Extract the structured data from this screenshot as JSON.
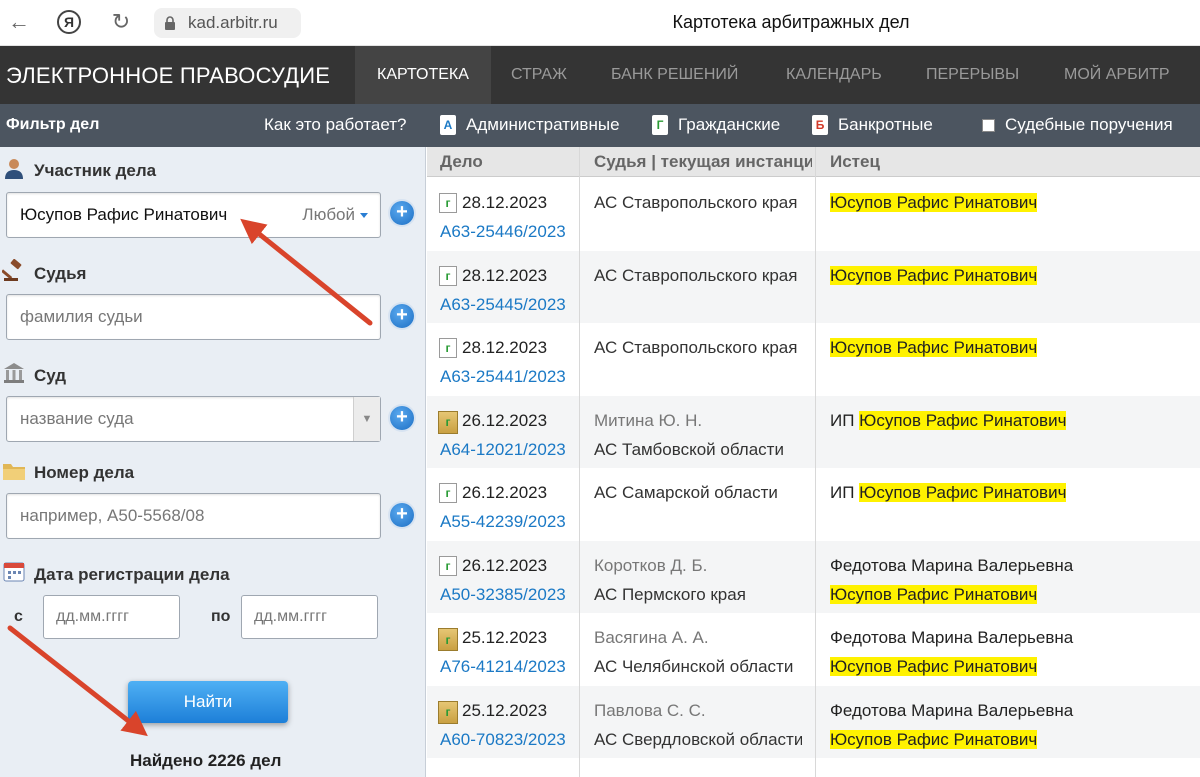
{
  "browser": {
    "url": "kad.arbitr.ru",
    "tab_title": "Картотека арбитражных дел",
    "yandex_label": "Я"
  },
  "topbar": {
    "brand": "ЭЛЕКТРОННОЕ ПРАВОСУДИЕ",
    "menu": [
      "КАРТОТЕКА",
      "СТРАЖ",
      "БАНК РЕШЕНИЙ",
      "КАЛЕНДАРЬ",
      "ПЕРЕРЫВЫ",
      "МОЙ АРБИТР"
    ],
    "active_menu": "КАРТОТЕКА"
  },
  "subbar": {
    "filter_title": "Фильтр дел",
    "how_it_works": "Как это работает?",
    "categories": [
      {
        "icon_letter": "А",
        "label": "Административные"
      },
      {
        "icon_letter": "Г",
        "label": "Гражданские"
      },
      {
        "icon_letter": "Б",
        "label": "Банкротные"
      },
      {
        "label": "Судебные поручения",
        "checked": false
      }
    ]
  },
  "filter": {
    "participant": {
      "label": "Участник дела",
      "value": "Юсупов Рафис Ринатович",
      "role": "Любой"
    },
    "judge": {
      "label": "Судья",
      "placeholder": "фамилия судьи"
    },
    "court": {
      "label": "Суд",
      "placeholder": "название суда"
    },
    "case_number": {
      "label": "Номер дела",
      "placeholder": "например, А50-5568/08"
    },
    "reg_date": {
      "label": "Дата регистрации дела",
      "from_label": "с",
      "to_label": "по",
      "from_placeholder": "дд.мм.гггг",
      "to_placeholder": "дд.мм.гггг"
    },
    "find_button": "Найти",
    "found_text": "Найдено 2226 дел"
  },
  "results": {
    "headers": [
      "Дело",
      "Судья | текущая инстанция",
      "Истец"
    ],
    "rows": [
      {
        "type": "doc",
        "date": "28.12.2023",
        "case": "А63-25446/2023",
        "judge": "",
        "court": "АС Ставропольского края",
        "plaintiff_prefix": "",
        "plaintiff_other": "",
        "plaintiff": "Юсупов Рафис Ринатович"
      },
      {
        "type": "doc",
        "date": "28.12.2023",
        "case": "А63-25445/2023",
        "judge": "",
        "court": "АС Ставропольского края",
        "plaintiff_prefix": "",
        "plaintiff_other": "",
        "plaintiff": "Юсупов Рафис Ринатович"
      },
      {
        "type": "doc",
        "date": "28.12.2023",
        "case": "А63-25441/2023",
        "judge": "",
        "court": "АС Ставропольского края",
        "plaintiff_prefix": "",
        "plaintiff_other": "",
        "plaintiff": "Юсупов Рафис Ринатович"
      },
      {
        "type": "folder",
        "date": "26.12.2023",
        "case": "А64-12021/2023",
        "judge": "Митина Ю. Н.",
        "court": "АС Тамбовской области",
        "plaintiff_prefix": "ИП ",
        "plaintiff_other": "",
        "plaintiff": "Юсупов Рафис Ринатович"
      },
      {
        "type": "doc",
        "date": "26.12.2023",
        "case": "А55-42239/2023",
        "judge": "",
        "court": "АС Самарской области",
        "plaintiff_prefix": "ИП ",
        "plaintiff_other": "",
        "plaintiff": "Юсупов Рафис Ринатович"
      },
      {
        "type": "doc",
        "date": "26.12.2023",
        "case": "А50-32385/2023",
        "judge": "Коротков Д. Б.",
        "court": "АС Пермского края",
        "plaintiff_prefix": "",
        "plaintiff_other": "Федотова Марина Валерьевна",
        "plaintiff": "Юсупов Рафис Ринатович"
      },
      {
        "type": "folder",
        "date": "25.12.2023",
        "case": "А76-41214/2023",
        "judge": "Васягина А. А.",
        "court": "АС Челябинской области",
        "plaintiff_prefix": "",
        "plaintiff_other": "Федотова Марина Валерьевна",
        "plaintiff": "Юсупов Рафис Ринатович"
      },
      {
        "type": "folder",
        "date": "25.12.2023",
        "case": "А60-70823/2023",
        "judge": "Павлова С. С.",
        "court": "АС Свердловской области",
        "plaintiff_prefix": "",
        "plaintiff_other": "Федотова Марина Валерьевна",
        "plaintiff": "Юсупов Рафис Ринатович"
      }
    ]
  },
  "colors": {
    "topbar": "#343434",
    "subbar": "#4c5560",
    "link": "#1b79c5",
    "highlight": "#fff200",
    "annotation_arrow": "#d9442b"
  }
}
